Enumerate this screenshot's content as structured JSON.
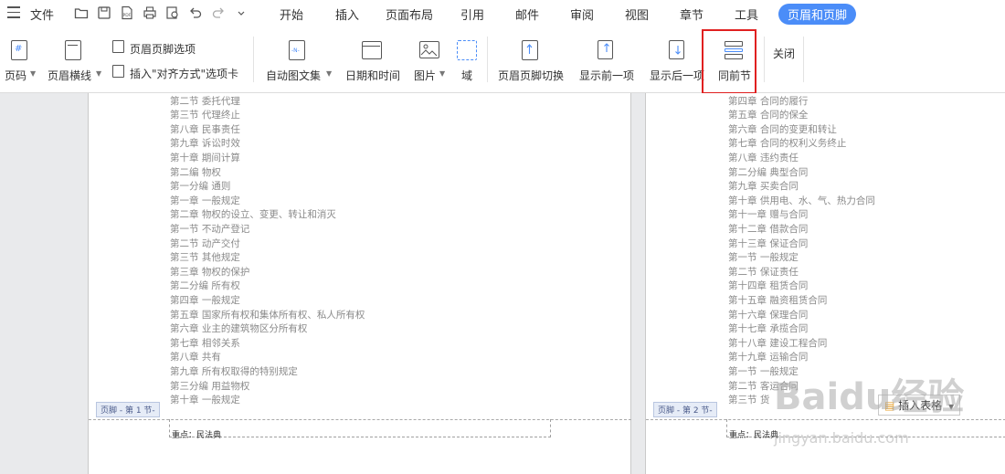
{
  "menubar": {
    "file": "文件",
    "tabs": [
      {
        "label": "开始"
      },
      {
        "label": "插入"
      },
      {
        "label": "页面布局"
      },
      {
        "label": "引用"
      },
      {
        "label": "邮件"
      },
      {
        "label": "审阅"
      },
      {
        "label": "视图"
      },
      {
        "label": "章节"
      },
      {
        "label": "工具"
      },
      {
        "label": "页眉和页脚",
        "active": true
      }
    ],
    "accent_color": "#4b8df8"
  },
  "ribbon": {
    "page_number": "页码",
    "header_line": "页眉横线",
    "hf_options": "页眉页脚选项",
    "insert_align_tab": "插入\"对齐方式\"选项卡",
    "auto_text": "自动图文集",
    "date_time": "日期和时间",
    "picture": "图片",
    "field": "域",
    "hf_switch": "页眉页脚切换",
    "show_prev": "显示前一项",
    "show_next": "显示后一项",
    "same_as_prev": "同前节",
    "close": "关闭"
  },
  "left_page": {
    "lines": [
      "第二节  委托代理",
      "第三节  代理终止",
      "第八章  民事责任",
      "第九章  诉讼时效",
      "第十章  期间计算",
      "第二编  物权",
      "第一分编  通则",
      "第一章  一般规定",
      "第二章  物权的设立、变更、转让和消灭",
      "第一节  不动产登记",
      "第二节  动产交付",
      "第三节  其他规定",
      "第三章  物权的保护",
      "第二分编  所有权",
      "第四章  一般规定",
      "第五章  国家所有权和集体所有权、私人所有权",
      "第六章  业主的建筑物区分所有权",
      "第七章  相邻关系",
      "第八章  共有",
      "第九章  所有权取得的特别规定",
      "第三分编  用益物权",
      "第十章  一般规定"
    ],
    "footer_tag": "页脚 - 第 1 节-",
    "footer_text": "重点：民法典"
  },
  "right_page": {
    "lines": [
      "第四章  合同的履行",
      "第五章  合同的保全",
      "第六章  合同的变更和转让",
      "第七章  合同的权利义务终止",
      "第八章  违约责任",
      "第二分编  典型合同",
      "第九章  买卖合同",
      "第十章  供用电、水、气、热力合同",
      "第十一章  赠与合同",
      "第十二章  借款合同",
      "第十三章  保证合同",
      "第一节  一般规定",
      "第二节  保证责任",
      "第十四章  租赁合同",
      "第十五章  融资租赁合同",
      "第十六章  保理合同",
      "第十七章  承揽合同",
      "第十八章  建设工程合同",
      "第十九章  运输合同",
      "第一节  一般规定",
      "第二节  客运合同",
      "第三节  货"
    ],
    "footer_tag": "页脚 - 第 2 节-",
    "footer_text": "重点：民法典",
    "insert_tab_button": "插入表格"
  },
  "watermark": {
    "brand": "Baidu经验",
    "url": "jingyan.baidu.com"
  }
}
